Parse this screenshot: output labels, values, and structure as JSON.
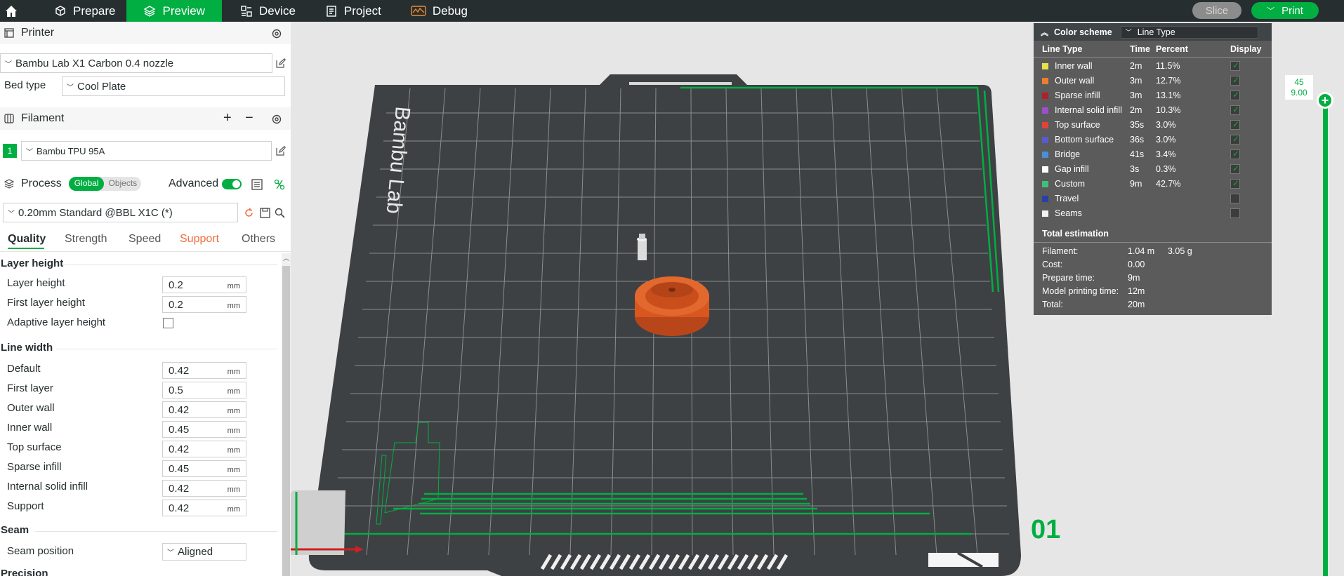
{
  "topbar": {
    "tabs": [
      {
        "label": "Prepare",
        "icon": "cube-icon"
      },
      {
        "label": "Preview",
        "icon": "layers-icon",
        "active": true
      },
      {
        "label": "Device",
        "icon": "device-icon"
      },
      {
        "label": "Project",
        "icon": "project-icon"
      },
      {
        "label": "Debug",
        "icon": "debug-icon"
      }
    ],
    "slice_label": "Slice",
    "print_label": "Print",
    "print_chevron": "﹀"
  },
  "sidebar": {
    "printer_title": "Printer",
    "printer_value": "Bambu Lab X1 Carbon 0.4 nozzle",
    "bed_type_label": "Bed type",
    "bed_type_value": "Cool Plate",
    "filament_title": "Filament",
    "filament_add": "+",
    "filament_remove": "−",
    "filament_index": "1",
    "filament_value": "Bambu TPU 95A",
    "process_title": "Process",
    "toggle_global": "Global",
    "toggle_objects": "Objects",
    "advanced_label": "Advanced",
    "process_value": "0.20mm Standard @BBL X1C (*)",
    "tabs": [
      "Quality",
      "Strength",
      "Speed",
      "Support",
      "Others"
    ],
    "groups": {
      "layer_height": {
        "title": "Layer height",
        "rows": [
          {
            "label": "Layer height",
            "value": "0.2",
            "unit": "mm"
          },
          {
            "label": "First layer height",
            "value": "0.2",
            "unit": "mm"
          }
        ],
        "adaptive_label": "Adaptive layer height"
      },
      "line_width": {
        "title": "Line width",
        "rows": [
          {
            "label": "Default",
            "value": "0.42",
            "unit": "mm"
          },
          {
            "label": "First layer",
            "value": "0.5",
            "unit": "mm"
          },
          {
            "label": "Outer wall",
            "value": "0.42",
            "unit": "mm"
          },
          {
            "label": "Inner wall",
            "value": "0.45",
            "unit": "mm"
          },
          {
            "label": "Top surface",
            "value": "0.42",
            "unit": "mm"
          },
          {
            "label": "Sparse infill",
            "value": "0.45",
            "unit": "mm"
          },
          {
            "label": "Internal solid infill",
            "value": "0.42",
            "unit": "mm"
          },
          {
            "label": "Support",
            "value": "0.42",
            "unit": "mm"
          }
        ]
      },
      "seam": {
        "title": "Seam",
        "position_label": "Seam position",
        "position_value": "Aligned"
      },
      "precision": {
        "title": "Precision"
      }
    }
  },
  "legend": {
    "header_label": "Color scheme",
    "scheme_value": "Line Type",
    "columns": [
      "Line Type",
      "Time",
      "Percent",
      "Display"
    ],
    "rows": [
      {
        "name": "Inner wall",
        "time": "2m",
        "percent": "11.5%",
        "color": "#e8e04a",
        "display": true
      },
      {
        "name": "Outer wall",
        "time": "3m",
        "percent": "12.7%",
        "color": "#f07c2e",
        "display": true
      },
      {
        "name": "Sparse infill",
        "time": "3m",
        "percent": "13.1%",
        "color": "#b0202a",
        "display": true
      },
      {
        "name": "Internal solid infill",
        "time": "2m",
        "percent": "10.3%",
        "color": "#9b4fcf",
        "display": true
      },
      {
        "name": "Top surface",
        "time": "35s",
        "percent": "3.0%",
        "color": "#e0433b",
        "display": true
      },
      {
        "name": "Bottom surface",
        "time": "36s",
        "percent": "3.0%",
        "color": "#5a5ad0",
        "display": true
      },
      {
        "name": "Bridge",
        "time": "41s",
        "percent": "3.4%",
        "color": "#4a8fd6",
        "display": true
      },
      {
        "name": "Gap infill",
        "time": "3s",
        "percent": "0.3%",
        "color": "#ffffff",
        "display": true
      },
      {
        "name": "Custom",
        "time": "9m",
        "percent": "42.7%",
        "color": "#3fc07a",
        "display": true
      },
      {
        "name": "Travel",
        "time": "",
        "percent": "",
        "color": "#2b3fa8",
        "display": false
      },
      {
        "name": "Seams",
        "time": "",
        "percent": "",
        "color": "#f2f2f2",
        "display": false
      }
    ],
    "estimation": {
      "title": "Total estimation",
      "filament_label": "Filament:",
      "filament_len": "1.04 m",
      "filament_weight": "3.05 g",
      "cost_label": "Cost:",
      "cost_value": "0.00",
      "prepare_label": "Prepare time:",
      "prepare_value": "9m",
      "model_label": "Model printing time:",
      "model_value": "12m",
      "total_label": "Total:",
      "total_value": "20m"
    }
  },
  "viewport": {
    "plate_brand": "Bambu Lab",
    "plate_number": "01",
    "layer_top": "45",
    "height_top": "9.00",
    "colors": {
      "accent": "#00ae42",
      "plate": "#3e4143",
      "object": "#d8571e"
    }
  }
}
